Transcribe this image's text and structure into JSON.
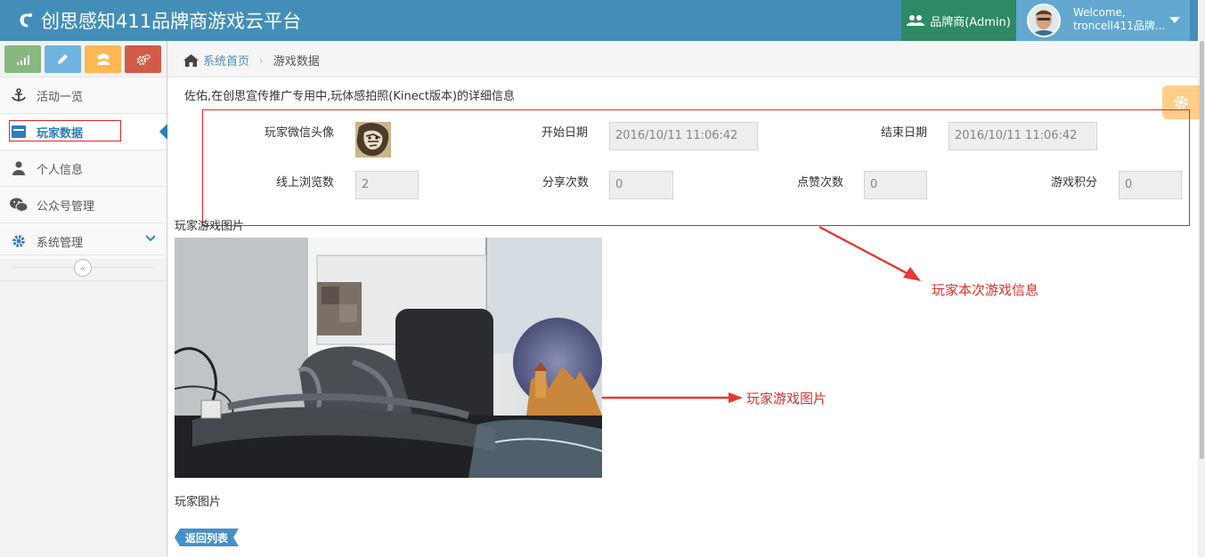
{
  "navbar": {
    "brand": "创思感知411品牌商游戏云平台",
    "role": "品牌商(Admin)",
    "welcome": "Welcome,",
    "username": "troncell411品牌..."
  },
  "sidebar": {
    "shortcuts": [
      "signal-icon",
      "pencil-icon",
      "users-icon",
      "cogs-icon"
    ],
    "items": [
      {
        "label": "活动一览",
        "icon": "anchor-icon"
      },
      {
        "label": "玩家数据",
        "icon": "inbox-icon"
      },
      {
        "label": "个人信息",
        "icon": "user-icon"
      },
      {
        "label": "公众号管理",
        "icon": "wechat-icon"
      },
      {
        "label": "系统管理",
        "icon": "cog-icon"
      }
    ],
    "collapse_glyph": "«"
  },
  "breadcrumb": {
    "home": "系统首页",
    "separator": "›",
    "current": "游戏数据"
  },
  "detail": {
    "title": "佐佑,在创思宣传推广专用中,玩体感拍照(Kinect版本)的详细信息",
    "fields": {
      "avatar_label": "玩家微信头像",
      "start_label": "开始日期",
      "start_value": "2016/10/11 11:06:42",
      "end_label": "结束日期",
      "end_value": "2016/10/11 11:06:42",
      "views_label": "线上浏览数",
      "views_value": "2",
      "shares_label": "分享次数",
      "shares_value": "0",
      "likes_label": "点赞次数",
      "likes_value": "0",
      "score_label": "游戏积分",
      "score_value": "0"
    },
    "game_photo_label": "玩家游戏图片",
    "player_photo_label": "玩家图片",
    "back_button": "返回列表"
  },
  "annotations": {
    "info": "玩家本次游戏信息",
    "photo": "玩家游戏图片"
  },
  "colors": {
    "navbar": "#438eb9",
    "role_bg": "#2e8965",
    "user_bg": "#62a8d1",
    "annotation": "#d9322b",
    "link": "#2b7dbc"
  }
}
